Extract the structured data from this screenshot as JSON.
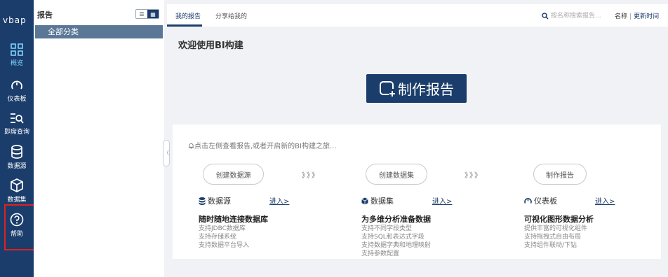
{
  "app": {
    "logo": "vbap"
  },
  "nav": {
    "overview": "概览",
    "dashboard": "仪表板",
    "adhoc": "即席查询",
    "datasource": "数据源",
    "dataset": "数据集",
    "help": "帮助"
  },
  "tree": {
    "title": "报告",
    "all_category": "全部分类",
    "collapse_glyph": "〈"
  },
  "header": {
    "tab_mine": "我的报告",
    "tab_shared": "分享给我的",
    "search_placeholder": "按名称搜索报告...",
    "sort_name": "名称",
    "sort_sep": "|",
    "sort_time": "更新时间"
  },
  "main": {
    "welcome": "欢迎使用BI构建",
    "make_report": "制作报告",
    "hint": "点击左侧查看报告,或者开启新的BI构建之旅...",
    "steps": [
      "创建数据源",
      "创建数据集",
      "制作报告"
    ],
    "arrows": "》》》",
    "columns": [
      {
        "title": "数据源",
        "enter": "进入>",
        "head": "随时随地连接数据库",
        "desc": [
          "支持JDBC数据库",
          "支持存储系统",
          "支持数据平台导入"
        ]
      },
      {
        "title": "数据集",
        "enter": "进入>",
        "head": "为多维分析准备数据",
        "desc": [
          "支持不同字段类型",
          "支持SQL和表达式字段",
          "支持数据字典和地理映射",
          "支持参数配置"
        ]
      },
      {
        "title": "仪表板",
        "enter": "进入>",
        "head": "可视化图形数据分析",
        "desc": [
          "提供丰富的可视化组件",
          "支持拖拽式自由布局",
          "支持组件联动/下钻"
        ]
      }
    ]
  },
  "colors": {
    "primary": "#1b3d6b",
    "highlight": "#e02020",
    "selected": "#5a7896"
  }
}
